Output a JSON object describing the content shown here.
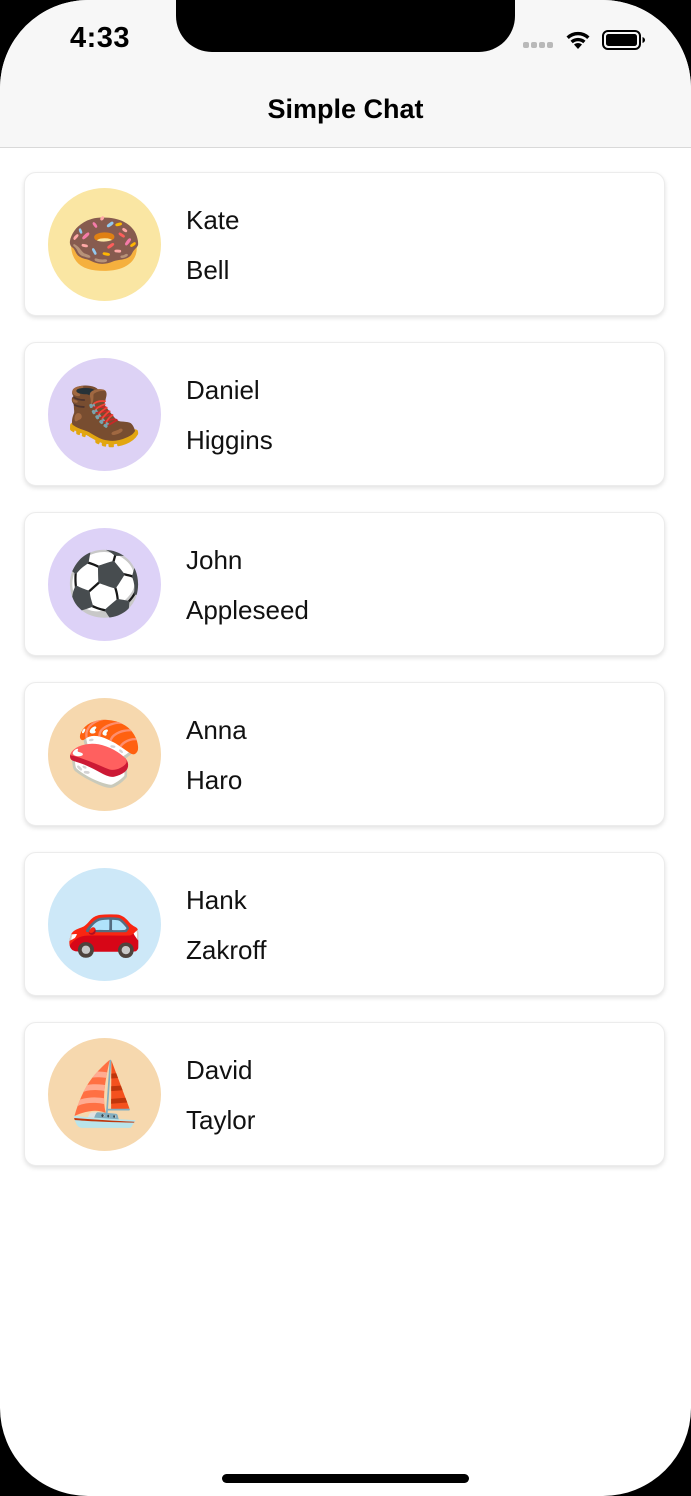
{
  "status_bar": {
    "time": "4:33"
  },
  "nav": {
    "title": "Simple Chat"
  },
  "contacts": [
    {
      "first_name": "Kate",
      "last_name": "Bell",
      "avatar_emoji": "🍩",
      "avatar_icon": "doughnut-icon",
      "avatar_color": "#fae6a3"
    },
    {
      "first_name": "Daniel",
      "last_name": "Higgins",
      "avatar_emoji": "🥾",
      "avatar_icon": "hiking-boot-icon",
      "avatar_color": "#ddd2f5"
    },
    {
      "first_name": "John",
      "last_name": "Appleseed",
      "avatar_emoji": "⚽",
      "avatar_icon": "soccer-ball-icon",
      "avatar_color": "#ddd2f7"
    },
    {
      "first_name": "Anna",
      "last_name": "Haro",
      "avatar_emoji": "🍣",
      "avatar_icon": "sushi-icon",
      "avatar_color": "#f6d8ae"
    },
    {
      "first_name": "Hank",
      "last_name": "Zakroff",
      "avatar_emoji": "🚗",
      "avatar_icon": "car-icon",
      "avatar_color": "#cde8f8"
    },
    {
      "first_name": "David",
      "last_name": "Taylor",
      "avatar_emoji": "⛵",
      "avatar_icon": "sailboat-icon",
      "avatar_color": "#f6d8ae"
    }
  ]
}
